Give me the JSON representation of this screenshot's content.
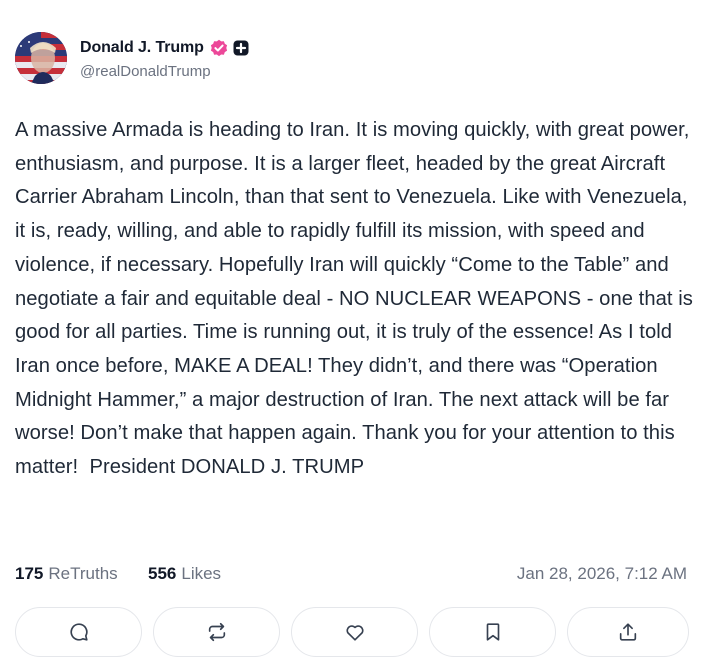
{
  "post": {
    "author": {
      "display_name": "Donald J. Trump",
      "handle": "@realDonaldTrump",
      "avatar_icon": "avatar-flag-portrait",
      "verified_icon": "verified-badge-icon",
      "verified_color": "#ec4899",
      "plus_icon": "plus-badge-icon"
    },
    "text": "A massive Armada is heading to Iran. It is moving quickly, with great power, enthusiasm, and purpose. It is a larger fleet, headed by the great Aircraft Carrier Abraham Lincoln, than that sent to Venezuela. Like with Venezuela, it is, ready, willing, and able to rapidly fulfill its mission, with speed and violence, if necessary. Hopefully Iran will quickly “Come to the Table” and negotiate a fair and equitable deal - NO NUCLEAR WEAPONS - one that is good for all parties. Time is running out, it is truly of the essence! As I told Iran once before, MAKE A DEAL! They didn’t, and there was “Operation Midnight Hammer,” a major destruction of Iran. The next attack will be far worse! Don’t make that happen again. Thank you for your attention to this matter!  President DONALD J. TRUMP",
    "stats": {
      "retruths_count": "175",
      "retruths_label": "ReTruths",
      "likes_count": "556",
      "likes_label": "Likes"
    },
    "timestamp": "Jan 28, 2026, 7:12 AM"
  },
  "actions": [
    {
      "name": "reply-button",
      "icon": "comment-icon"
    },
    {
      "name": "retruth-button",
      "icon": "repost-icon"
    },
    {
      "name": "like-button",
      "icon": "heart-icon"
    },
    {
      "name": "bookmark-button",
      "icon": "bookmark-icon"
    },
    {
      "name": "share-button",
      "icon": "share-icon"
    }
  ],
  "colors": {
    "text": "#1f2937",
    "muted": "#6b7280",
    "border": "#e5e7eb",
    "verified": "#ec4899"
  }
}
